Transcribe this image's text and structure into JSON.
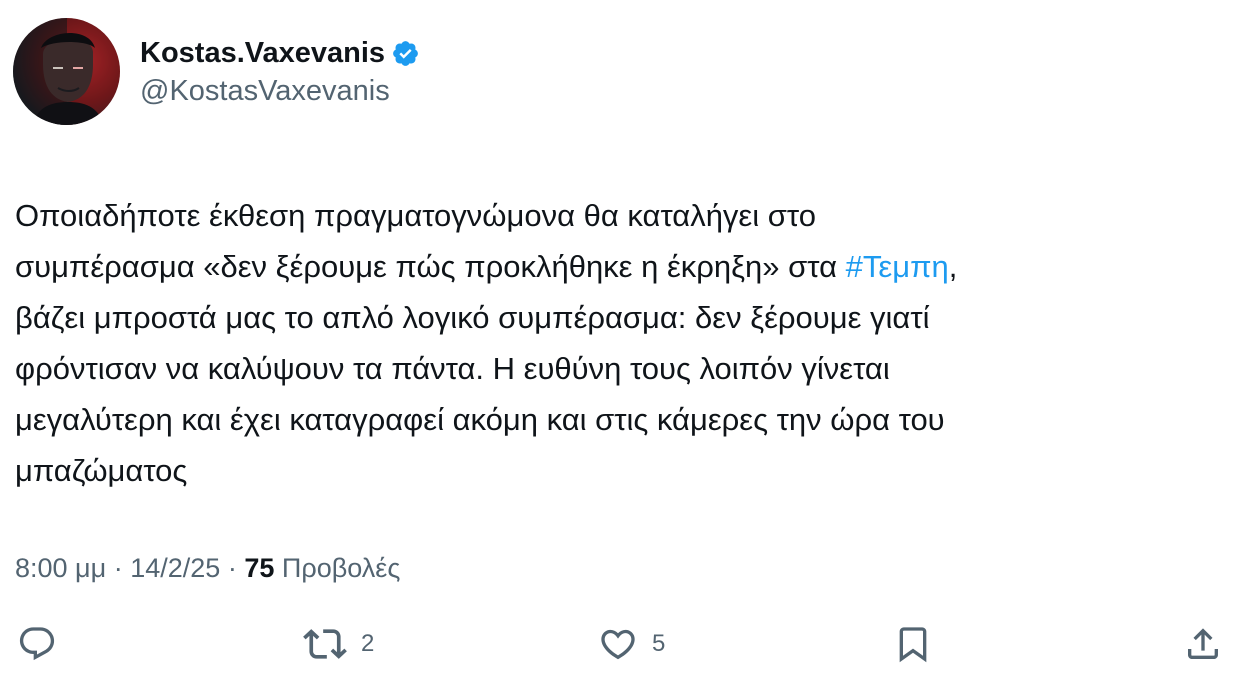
{
  "author": {
    "display_name": "Kostas.Vaxevanis",
    "handle": "@KostasVaxevanis",
    "verified": true,
    "verified_color": "#1d9bf0"
  },
  "tweet": {
    "lines": [
      "Οποιαδήποτε έκθεση πραγματογνώμονα θα καταλήγει στο",
      "συμπέρασμα «δεν ξέρουμε πώς προκλήθηκε η έκρηξη» στα ",
      "βάζει μπροστά μας το απλό λογικό συμπέρασμα: δεν ξέρουμε γιατί",
      "φρόντισαν να καλύψουν τα πάντα. Η ευθύνη τους λοιπόν γίνεται",
      "μεγαλύτερη και έχει καταγραφεί ακόμη και στις κάμερες την ώρα του",
      "μπαζώματος"
    ],
    "hashtag": "#Τεμπη",
    "after_hashtag": ",",
    "hashtag_color": "#1d9bf0"
  },
  "meta": {
    "time": "8:00 μμ",
    "separator": "·",
    "date": "14/2/25",
    "views_count": "75",
    "views_label": "Προβολές"
  },
  "actions": {
    "reply": {
      "icon": "reply-icon",
      "count": ""
    },
    "retweet": {
      "icon": "retweet-icon",
      "count": "2"
    },
    "like": {
      "icon": "heart-icon",
      "count": "5"
    },
    "bookmark": {
      "icon": "bookmark-icon"
    },
    "share": {
      "icon": "share-icon"
    }
  }
}
